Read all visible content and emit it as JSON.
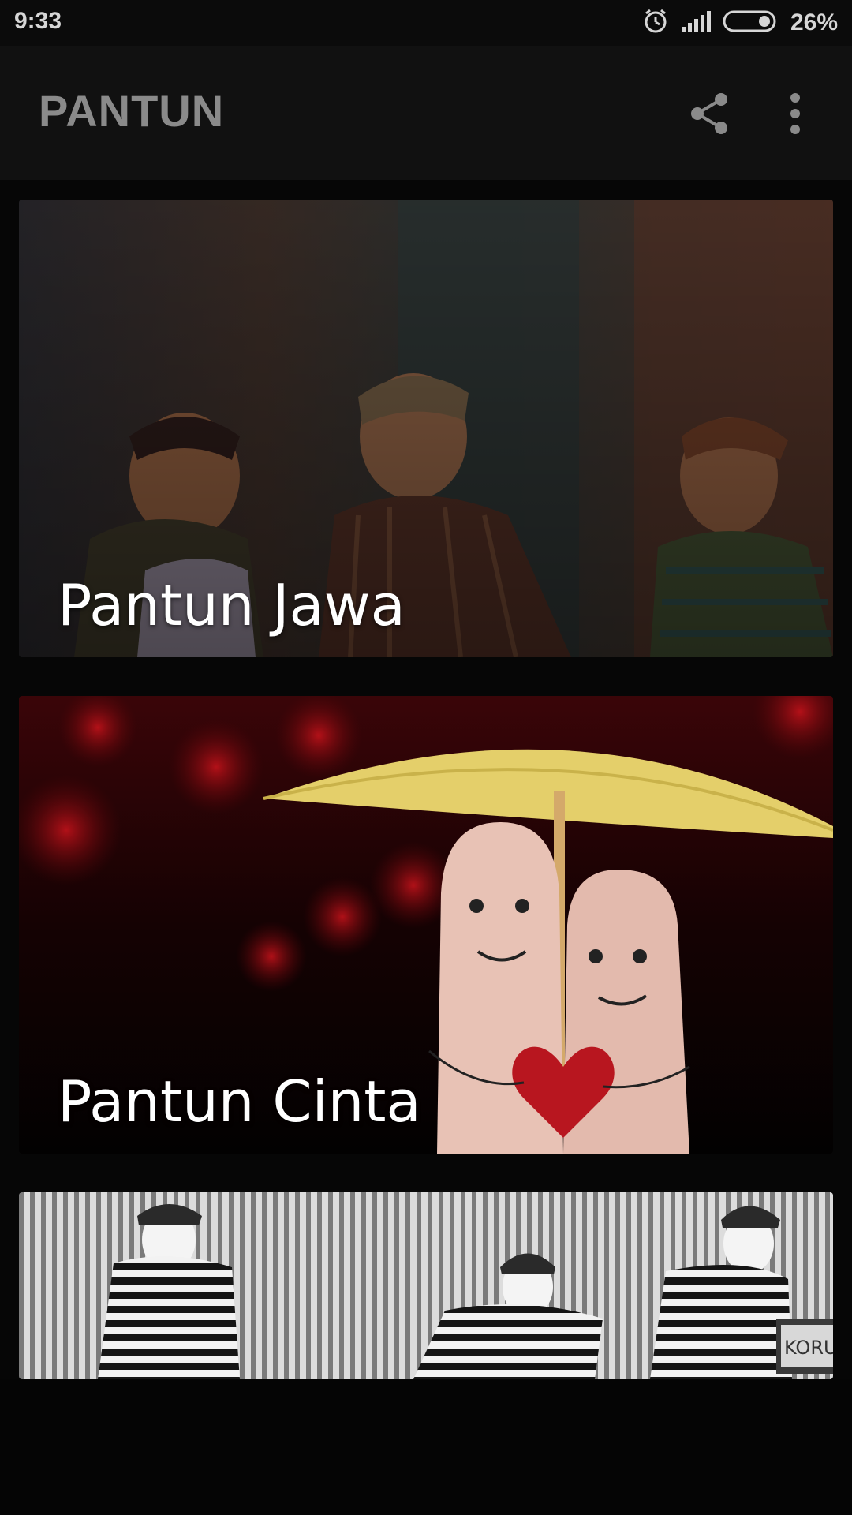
{
  "status_bar": {
    "time": "9:33",
    "battery": "26%",
    "icons": [
      "alarm-icon",
      "signal-icon",
      "battery-icon"
    ]
  },
  "app_bar": {
    "title": "PANTUN",
    "actions": [
      "share-icon",
      "more-vert-icon"
    ]
  },
  "cards": [
    {
      "label": "Pantun Jawa"
    },
    {
      "label": "Pantun Cinta"
    },
    {
      "label": "",
      "sign_text": "KORUP"
    }
  ],
  "colors": {
    "app_bar_bg": "#111111",
    "title_color": "#8a8a8a",
    "background": "#060606"
  }
}
